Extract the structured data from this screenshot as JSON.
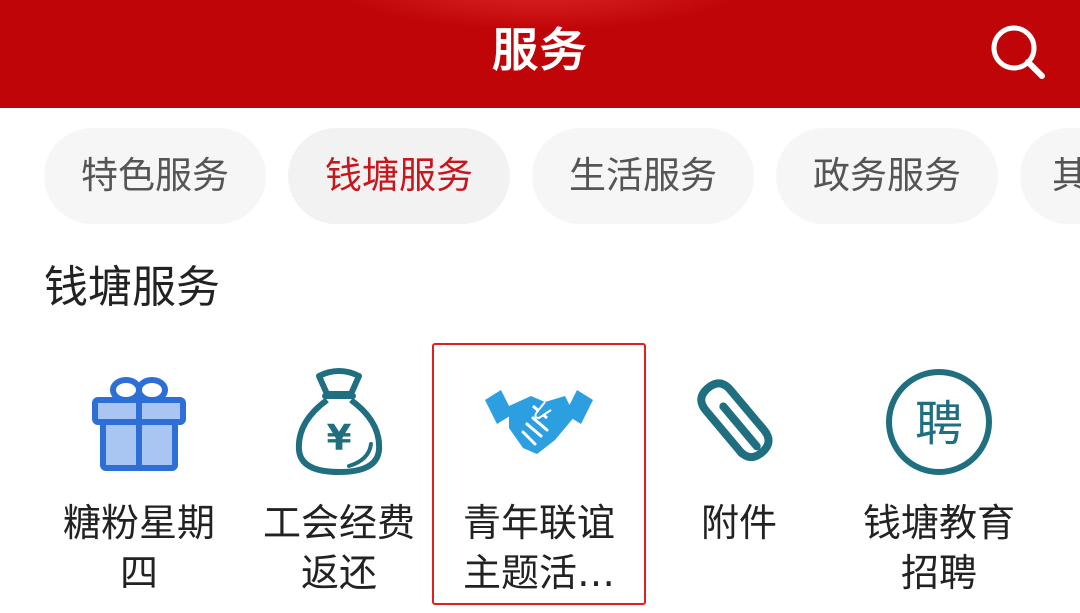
{
  "header": {
    "title": "服务",
    "search_icon": "search-icon"
  },
  "tabs": [
    {
      "label": "特色服务",
      "active": false
    },
    {
      "label": "钱塘服务",
      "active": true
    },
    {
      "label": "生活服务",
      "active": false
    },
    {
      "label": "政务服务",
      "active": false
    },
    {
      "label": "其",
      "active": false
    }
  ],
  "section": {
    "title": "钱塘服务"
  },
  "services": [
    {
      "line1": "糖粉星期",
      "line2": "四",
      "icon": "gift-icon"
    },
    {
      "line1": "工会经费",
      "line2": "返还",
      "icon": "money-bag-icon"
    },
    {
      "line1": "青年联谊",
      "line2": "主题活…",
      "icon": "handshake-icon",
      "highlighted": true
    },
    {
      "line1": "附件",
      "line2": "",
      "icon": "paperclip-icon"
    },
    {
      "line1": "钱塘教育",
      "line2": "招聘",
      "icon": "recruit-icon"
    }
  ],
  "colors": {
    "header_red": "#c00508",
    "active_tab_text": "#c8161d",
    "icon_blue": "#2e6fd6",
    "icon_teal": "#1f6f80",
    "icon_sky": "#2b9fe0",
    "highlight_border": "#e02020"
  },
  "icons": {
    "recruit_glyph": "聘",
    "money_glyph": "¥"
  }
}
